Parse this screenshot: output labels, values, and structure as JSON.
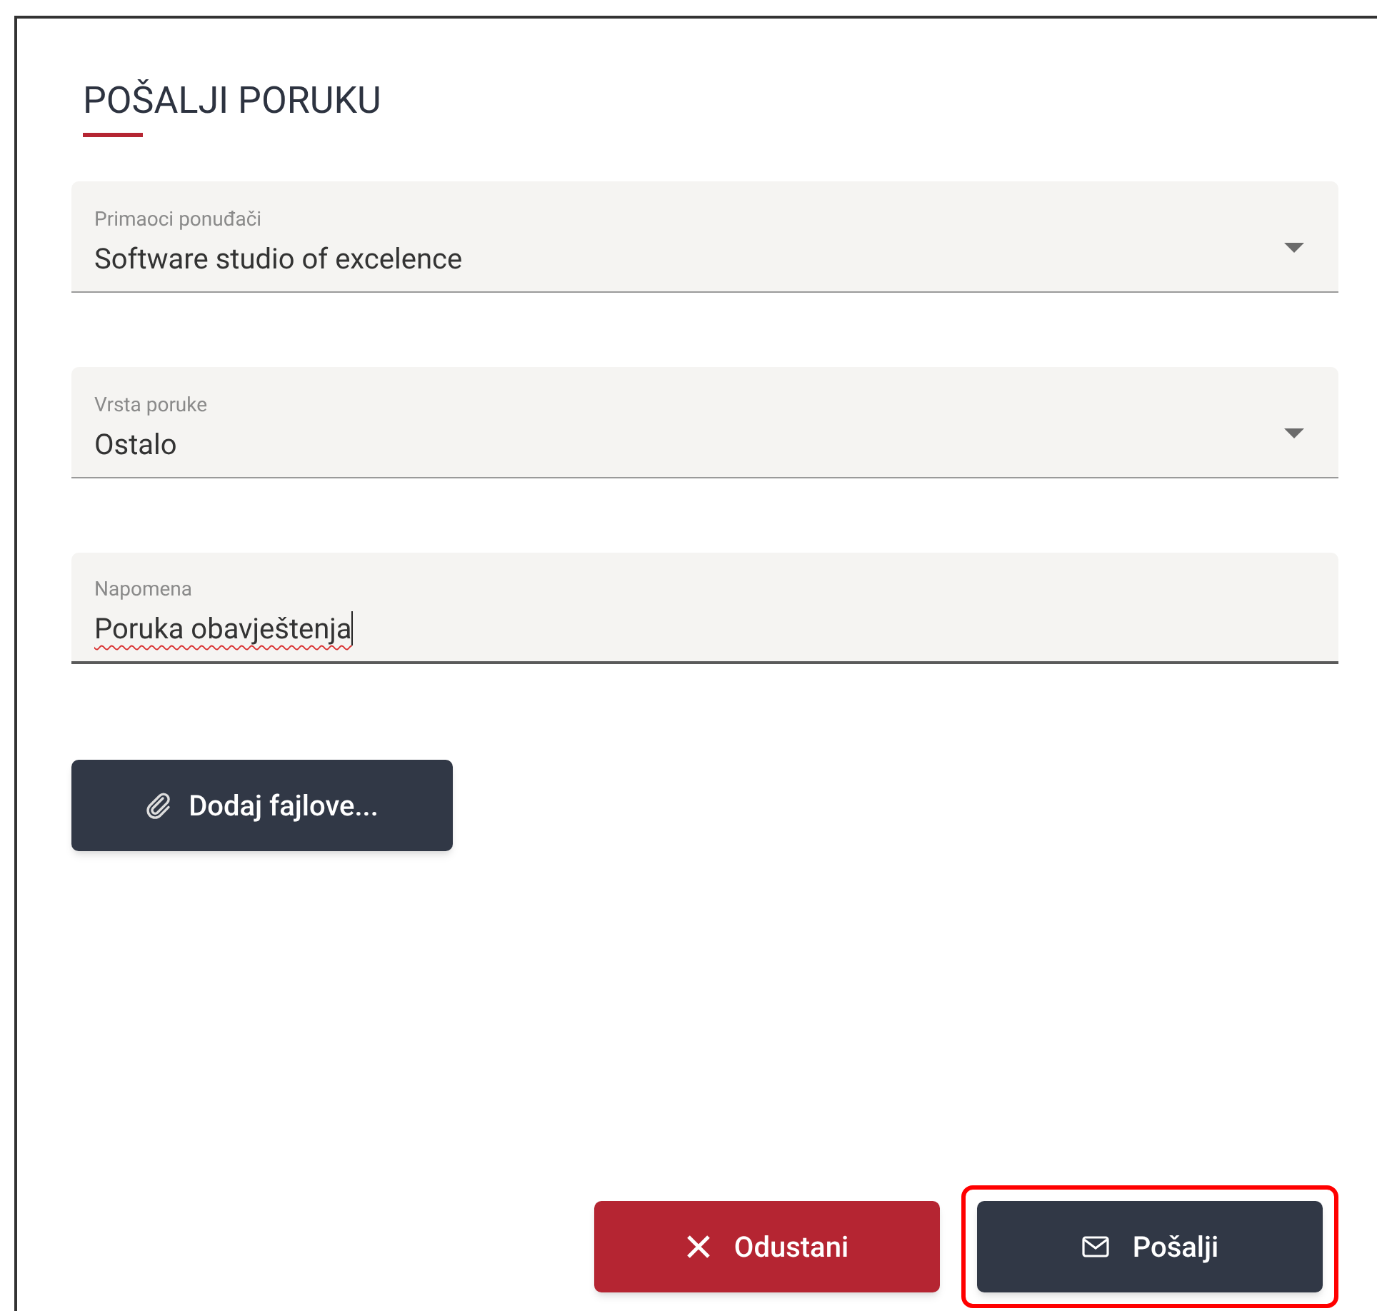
{
  "dialog": {
    "title": "POŠALJI PORUKU"
  },
  "fields": [
    {
      "kind": "select",
      "label": "Primaoci ponuđači",
      "value": "Software studio of excelence",
      "focused": false
    },
    {
      "kind": "select",
      "label": "Vrsta poruke",
      "value": "Ostalo",
      "focused": false
    },
    {
      "kind": "text",
      "label": "Napomena",
      "value": "Poruka obavještenja",
      "focused": true
    }
  ],
  "attach_button": {
    "label": "Dodaj fajlove..."
  },
  "actions": [
    {
      "kind": "cancel",
      "label": "Odustani",
      "highlighted": false
    },
    {
      "kind": "send",
      "label": "Pošalji",
      "highlighted": true
    }
  ]
}
